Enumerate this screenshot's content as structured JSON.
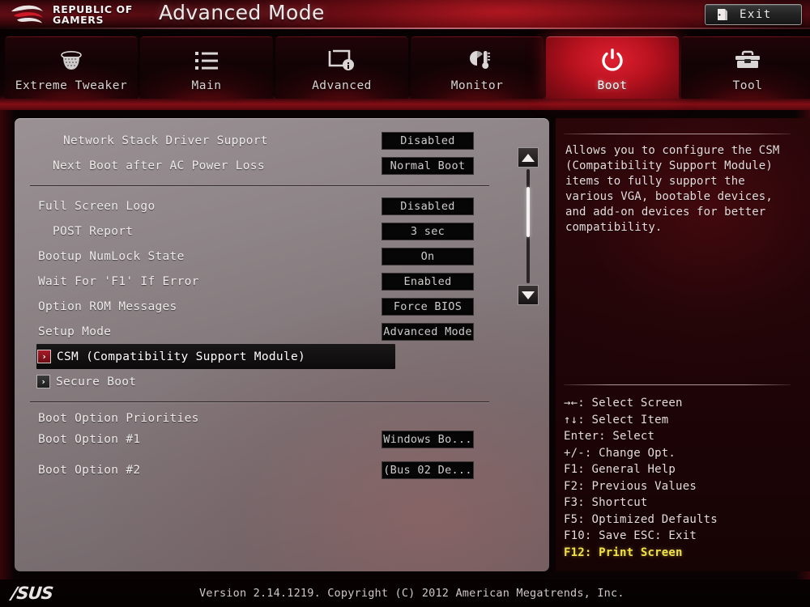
{
  "header": {
    "brand_line1": "REPUBLIC OF",
    "brand_line2": "GAMERS",
    "title": "Advanced Mode",
    "exit_label": "Exit",
    "exit_icon": "exit-door-icon",
    "accent_color": "#b8121f"
  },
  "tabs": [
    {
      "label": "Extreme Tweaker",
      "icon": "tweaker-icon",
      "active": false
    },
    {
      "label": "Main",
      "icon": "list-icon",
      "active": false
    },
    {
      "label": "Advanced",
      "icon": "monitor-info-icon",
      "active": false
    },
    {
      "label": "Monitor",
      "icon": "gauge-thermometer-icon",
      "active": false
    },
    {
      "label": "Boot",
      "icon": "power-icon",
      "active": true
    },
    {
      "label": "Tool",
      "icon": "toolbox-icon",
      "active": false
    }
  ],
  "settings": {
    "group1": [
      {
        "label": "Network Stack Driver Support",
        "value": "Disabled",
        "indent": 2
      },
      {
        "label": "Next Boot after AC Power Loss",
        "value": "Normal Boot",
        "indent": 1
      }
    ],
    "group2": [
      {
        "label": "Full Screen Logo",
        "value": "Disabled",
        "indent": 0
      },
      {
        "label": "POST Report",
        "value": "3 sec",
        "indent": 1
      },
      {
        "label": "Bootup NumLock State",
        "value": "On",
        "indent": 0
      },
      {
        "label": "Wait For 'F1' If Error",
        "value": "Enabled",
        "indent": 0
      },
      {
        "label": "Option ROM Messages",
        "value": "Force BIOS",
        "indent": 0
      },
      {
        "label": "Setup Mode",
        "value": "Advanced Mode",
        "indent": 0
      }
    ],
    "submenus": [
      {
        "label": "CSM (Compatibility Support Module)",
        "selected": true,
        "arrow": "›"
      },
      {
        "label": "Secure Boot",
        "selected": false,
        "arrow": "›"
      }
    ],
    "group3_title": "Boot Option Priorities",
    "group3": [
      {
        "label": "Boot Option #1",
        "value": "Windows Bo...",
        "indent": 0
      },
      {
        "label": "Boot Option #2",
        "value": "(Bus 02 De...",
        "indent": 0
      }
    ]
  },
  "scrollbar": {
    "up_icon": "scroll-up-arrow-icon",
    "down_icon": "scroll-down-arrow-icon"
  },
  "help": {
    "text": "Allows you to configure the CSM (Compatibility Support Module) items to fully support the various VGA, bootable devices, and add-on devices for better compatibility."
  },
  "key_legend": [
    {
      "text": "→←: Select Screen",
      "highlight": false
    },
    {
      "text": "↑↓: Select Item",
      "highlight": false
    },
    {
      "text": "Enter: Select",
      "highlight": false
    },
    {
      "text": "+/-: Change Opt.",
      "highlight": false
    },
    {
      "text": "F1: General Help",
      "highlight": false
    },
    {
      "text": "F2: Previous Values",
      "highlight": false
    },
    {
      "text": "F3: Shortcut",
      "highlight": false
    },
    {
      "text": "F5: Optimized Defaults",
      "highlight": false
    },
    {
      "text": "F10: Save  ESC: Exit",
      "highlight": false
    },
    {
      "text": "F12: Print Screen",
      "highlight": true
    }
  ],
  "footer": {
    "logo": "/SUS",
    "version": "Version 2.14.1219. Copyright (C) 2012 American Megatrends, Inc."
  }
}
